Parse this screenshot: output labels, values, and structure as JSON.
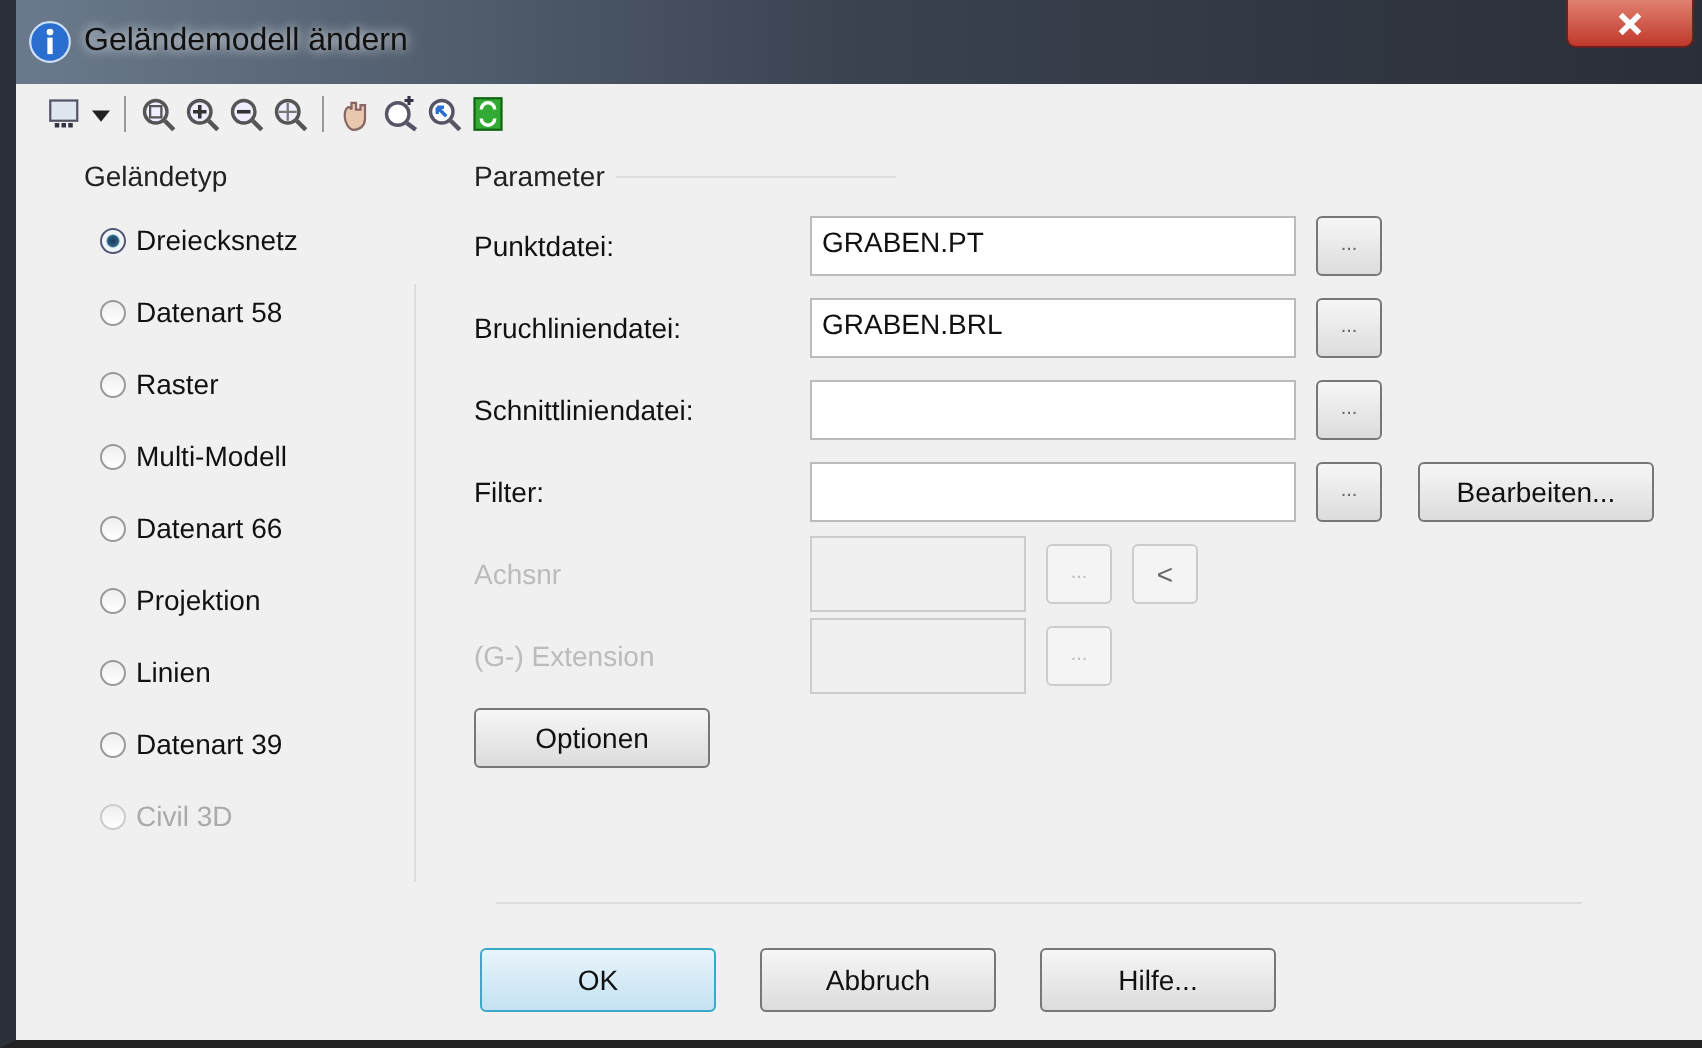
{
  "window": {
    "title": "Geländemodell ändern"
  },
  "terrain_type": {
    "label": "Geländetyp",
    "options": [
      {
        "label": "Dreiecksnetz",
        "selected": true,
        "disabled": false
      },
      {
        "label": "Datenart 58",
        "selected": false,
        "disabled": false
      },
      {
        "label": "Raster",
        "selected": false,
        "disabled": false
      },
      {
        "label": "Multi-Modell",
        "selected": false,
        "disabled": false
      },
      {
        "label": "Datenart 66",
        "selected": false,
        "disabled": false
      },
      {
        "label": "Projektion",
        "selected": false,
        "disabled": false
      },
      {
        "label": "Linien",
        "selected": false,
        "disabled": false
      },
      {
        "label": "Datenart 39",
        "selected": false,
        "disabled": false
      },
      {
        "label": "Civil 3D",
        "selected": false,
        "disabled": true
      }
    ]
  },
  "parameters": {
    "label": "Parameter",
    "fields": [
      {
        "label": "Punktdatei:",
        "value": "GRABEN.PT",
        "browse": "...",
        "disabled": false
      },
      {
        "label": "Bruchliniendatei:",
        "value": "GRABEN.BRL",
        "browse": "...",
        "disabled": false
      },
      {
        "label": "Schnittliniendatei:",
        "browse": "...",
        "disabled": false
      },
      {
        "label": "Filter:",
        "browse": "...",
        "disabled": false,
        "action": "Bearbeiten..."
      },
      {
        "label": "Achsnr",
        "browse": "...",
        "disabled": true,
        "action": "<"
      },
      {
        "label": "(G-) Extension",
        "browse": "...",
        "disabled": true
      }
    ],
    "options_button": "Optionen"
  },
  "buttons": [
    {
      "label": "OK",
      "default": true
    },
    {
      "label": "Abbruch",
      "default": false
    },
    {
      "label": "Hilfe...",
      "default": false
    }
  ]
}
